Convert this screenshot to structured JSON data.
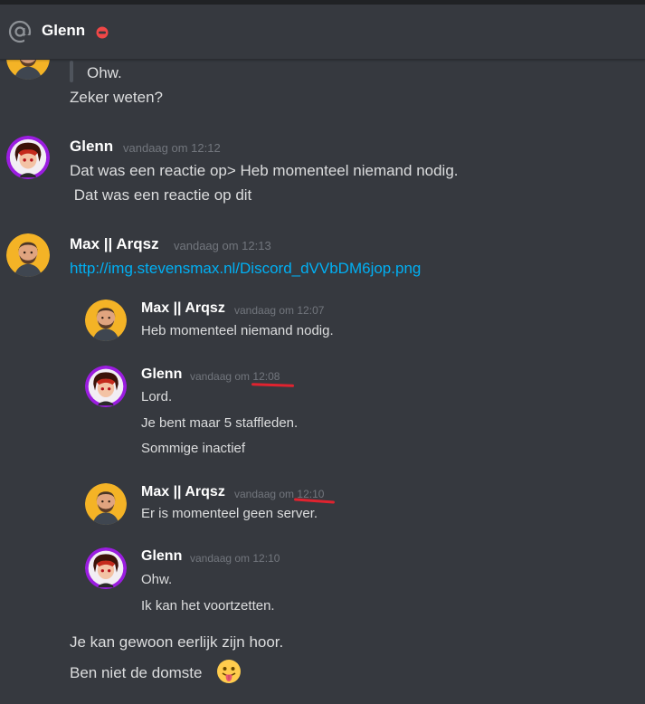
{
  "header": {
    "title": "Glenn",
    "icon": "at-icon",
    "status": "do-not-disturb",
    "status_color": "#f04747"
  },
  "messages": [
    {
      "lines": [
        "Ohw.",
        "Zeker weten?"
      ]
    },
    {
      "author": "Glenn",
      "timestamp": "vandaag om 12:12",
      "lines": [
        "Dat was een reactie op> Heb momenteel niemand nodig.",
        " Dat was een reactie op dit"
      ]
    },
    {
      "author": "Max || Arqsz",
      "timestamp": "vandaag om 12:13",
      "link": "http://img.stevensmax.nl/Discord_dVVbDM6jop.png",
      "embedded": [
        {
          "author": "Max || Arqsz",
          "timestamp": "vandaag om 12:07",
          "lines": [
            "Heb momenteel niemand nodig."
          ]
        },
        {
          "author": "Glenn",
          "timestamp_prefix": "vandaag om ",
          "timestamp_time": "12:08",
          "lines": [
            "Lord.",
            "Je bent maar 5 staffleden.",
            "Sommige inactief"
          ]
        },
        {
          "author": "Max || Arqsz",
          "timestamp_prefix": "vandaag om ",
          "timestamp_time": "12:10",
          "lines": [
            "Er is momenteel geen server."
          ]
        },
        {
          "author": "Glenn",
          "timestamp": "vandaag om 12:10",
          "lines": [
            "Ohw.",
            "Ik kan het voortzetten."
          ]
        }
      ],
      "lines": [
        "Je kan gewoon eerlijk zijn hoor.",
        "Ben niet de domste"
      ],
      "emoji": "stuck-out-tongue-emoji"
    }
  ],
  "colors": {
    "background": "#36393f",
    "link": "#00b0f4",
    "annotation": "#e0232f",
    "glenn_ring": "#9b1de0",
    "max_avatar_bg": "#f5b324"
  }
}
